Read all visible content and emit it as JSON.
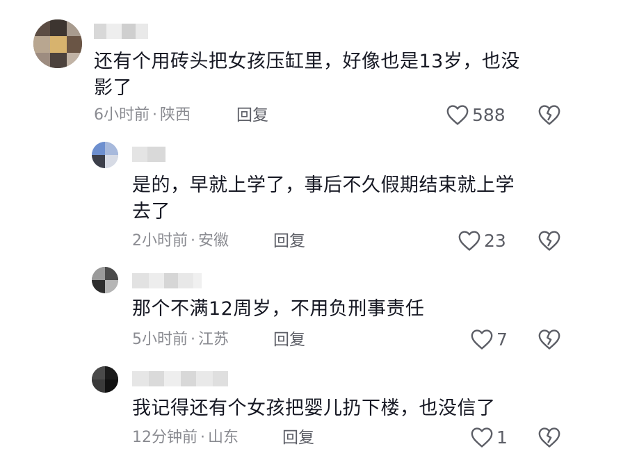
{
  "comments": [
    {
      "text_line1": "还有个用砖头把女孩压缸里，好像也是13岁，也没",
      "text_line2": "影了",
      "time": "6小时前",
      "location": "陕西",
      "reply_label": "回复",
      "likes": "588"
    },
    {
      "text_line1": "是的，早就上学了，事后不久假期结束就上学",
      "text_line2": "去了",
      "time": "2小时前",
      "location": "安徽",
      "reply_label": "回复",
      "likes": "23"
    },
    {
      "text_line1": "那个不满12周岁，不用负刑事责任",
      "time": "5小时前",
      "location": "江苏",
      "reply_label": "回复",
      "likes": "7"
    },
    {
      "text_line1": "我记得还有个女孩把婴儿扔下楼，也没信了",
      "time": "12分钟前",
      "location": "山东",
      "reply_label": "回复",
      "likes": "1"
    }
  ],
  "meta_separator": "·",
  "icons": {
    "like": "heart-outline-icon",
    "dislike": "broken-heart-icon"
  },
  "colors": {
    "text": "#161823",
    "meta": "#8a8b91",
    "icon": "#5c5e66"
  }
}
